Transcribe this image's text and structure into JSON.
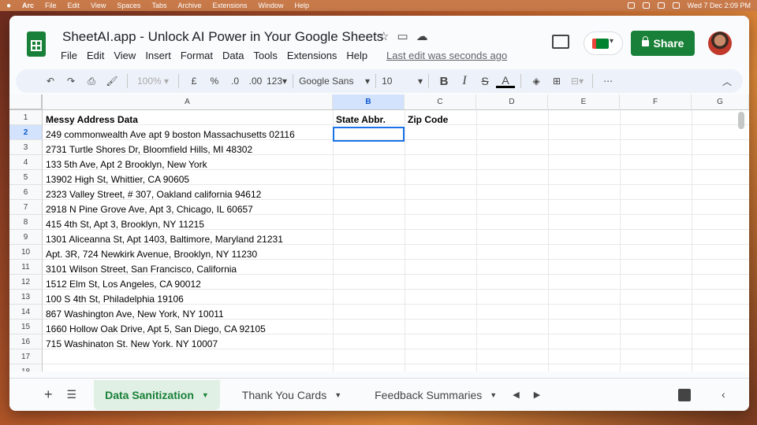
{
  "menubar": {
    "app": "Arc",
    "items": [
      "File",
      "Edit",
      "View",
      "Spaces",
      "Tabs",
      "Archive",
      "Extensions",
      "Window",
      "Help"
    ],
    "clock": "Wed 7 Dec  2:09 PM"
  },
  "doc": {
    "title": "SheetAI.app - Unlock AI Power in Your Google Sheets",
    "menus": [
      "File",
      "Edit",
      "View",
      "Insert",
      "Format",
      "Data",
      "Tools",
      "Extensions",
      "Help"
    ],
    "last_edit": "Last edit was seconds ago",
    "share_label": "Share"
  },
  "toolbar": {
    "zoom": "100%",
    "currency": "£",
    "percent": "%",
    "dec_less": ".0",
    "dec_more": ".00",
    "format_more": "123",
    "font": "Google Sans",
    "font_size": "10",
    "bold": "B",
    "italic": "I",
    "strike": "S",
    "text_color": "A",
    "more": "⋯"
  },
  "columns": [
    "A",
    "B",
    "C",
    "D",
    "E",
    "F",
    "G"
  ],
  "rows": [
    "1",
    "2",
    "3",
    "4",
    "5",
    "6",
    "7",
    "8",
    "9",
    "10",
    "11",
    "12",
    "13",
    "14",
    "15",
    "16",
    "17",
    "18"
  ],
  "headers": {
    "a": "Messy Address Data",
    "b": "State Abbr.",
    "c": "Zip Code"
  },
  "addresses": [
    "249 commonwealth Ave apt 9 boston Massachusetts 02116",
    "2731 Turtle Shores Dr, Bloomfield Hills, MI 48302",
    "133 5th Ave, Apt 2 Brooklyn, New York",
    "13902 High St, Whittier, CA 90605",
    "2323 Valley Street, # 307, Oakland california 94612",
    "2918 N Pine Grove Ave, Apt 3, Chicago, IL 60657",
    "415 4th St, Apt 3, Brooklyn, NY 11215",
    "1301 Aliceanna St, Apt 1403, Baltimore, Maryland 21231",
    "Apt. 3R, 724 Newkirk Avenue, Brooklyn, NY 11230",
    "3101 Wilson Street, San Francisco, California",
    "1512 Elm St, Los Angeles, CA 90012",
    "100 S 4th St, Philadelphia 19106",
    "867 Washington Ave, New York, NY 10011",
    "1660 Hollow Oak Drive, Apt 5, San Diego, CA 92105",
    "715 Washinaton St. New York. NY 10007"
  ],
  "sheet_tabs": [
    "Data Sanitization",
    "Thank You Cards",
    "Feedback Summaries"
  ]
}
